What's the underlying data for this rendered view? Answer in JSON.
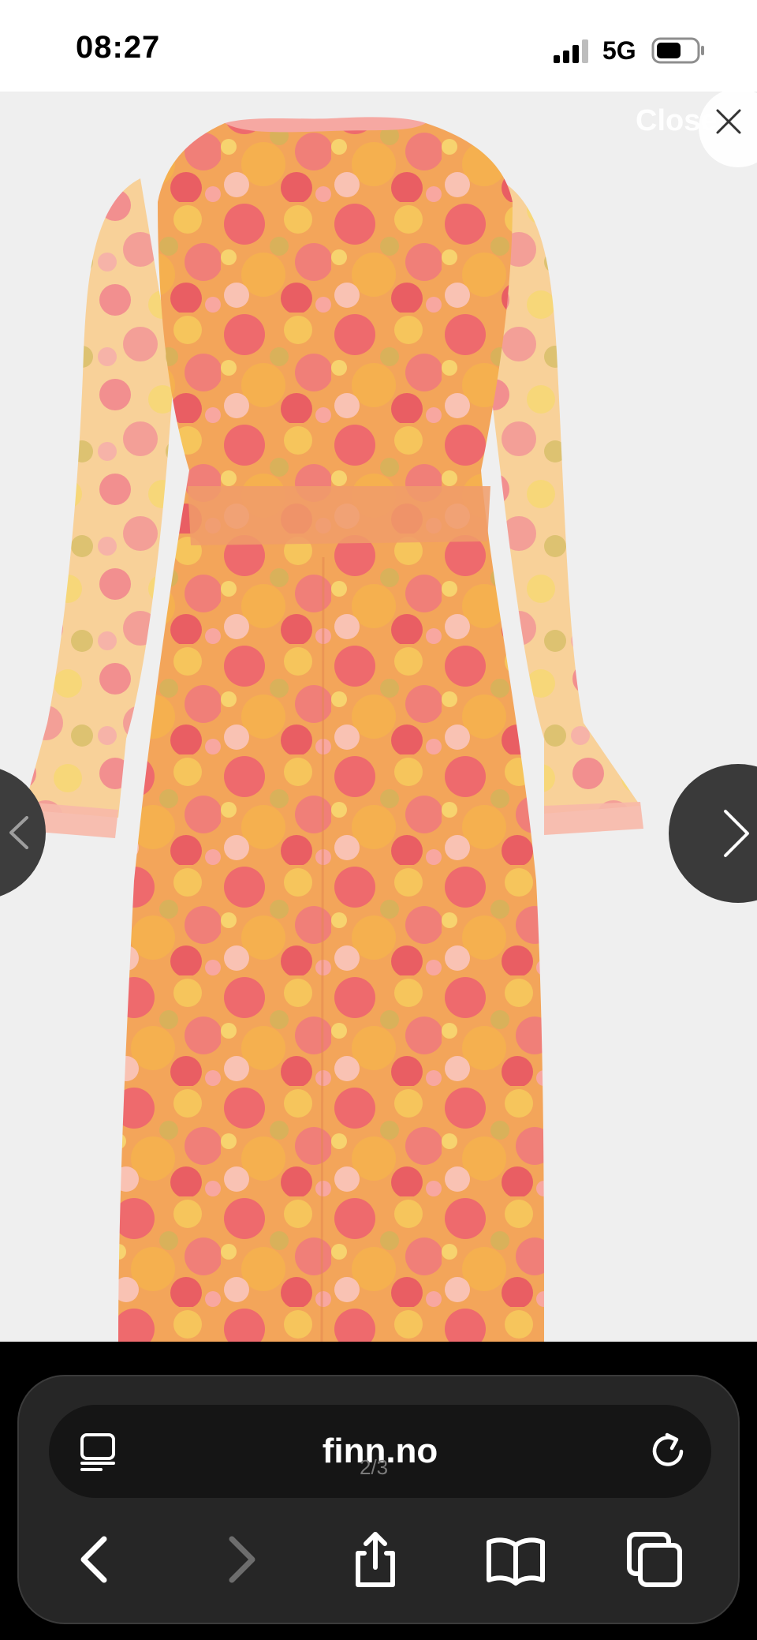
{
  "status_bar": {
    "time": "08:27",
    "network": "5G",
    "icons": [
      "signal-icon",
      "battery-icon"
    ]
  },
  "viewer": {
    "close_label": "Close",
    "page_indicator": "2/3",
    "icons": [
      "close-icon",
      "chevron-left-icon",
      "chevron-right-icon"
    ]
  },
  "browser": {
    "url": "finn.no",
    "icons": [
      "reader-icon",
      "reload-icon",
      "back-icon",
      "forward-icon",
      "share-icon",
      "bookmarks-icon",
      "tabs-icon"
    ]
  },
  "colors": {
    "panel_background": "#262626",
    "address_background": "#151515",
    "dress_coral": "#ef6f6f",
    "dress_orange": "#f2a645",
    "dress_yellow": "#f4c85a"
  }
}
